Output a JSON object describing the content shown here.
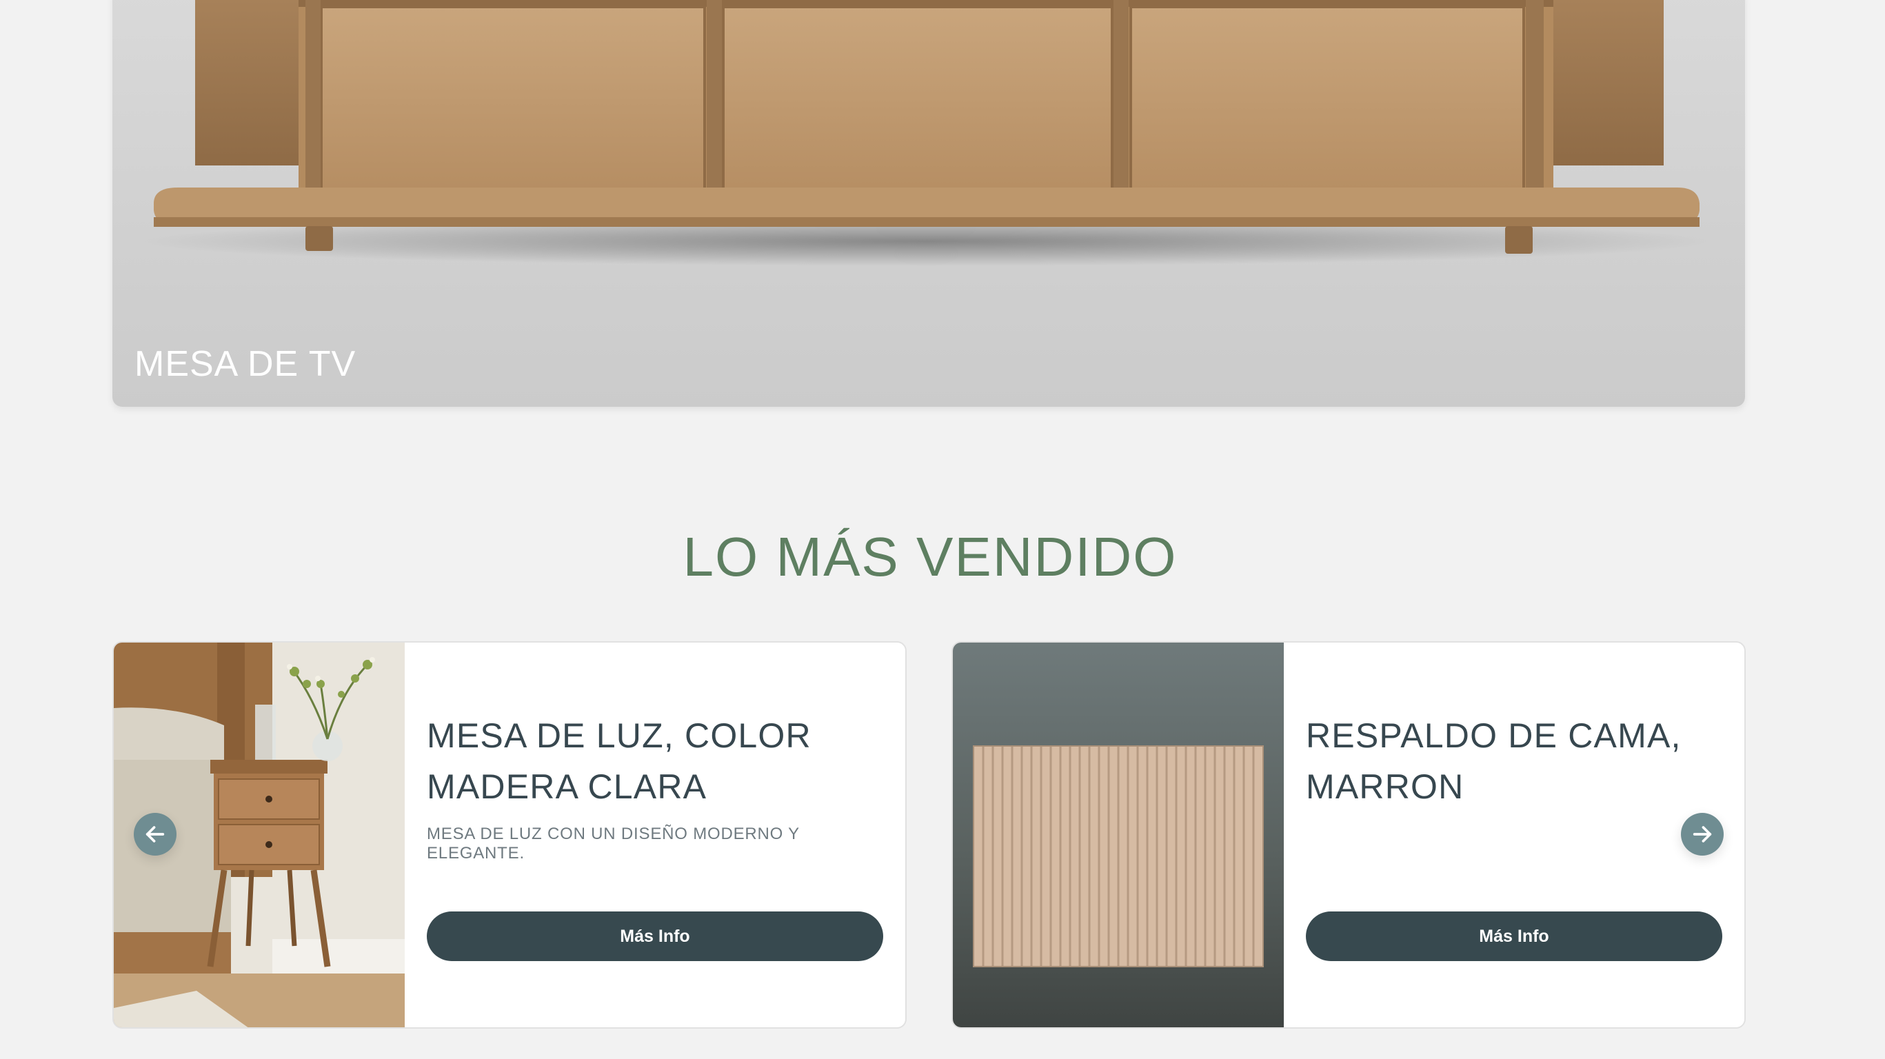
{
  "hero": {
    "title": "MESA DE TV"
  },
  "section": {
    "title": "LO MÁS VENDIDO"
  },
  "products": [
    {
      "title_line1": "MESA DE LUZ, COLOR",
      "title_line2": "MADERA CLARA",
      "description": "MESA DE LUZ CON UN DISEÑO MODERNO Y ELEGANTE.",
      "button_label": "Más Info"
    },
    {
      "title_line1": "RESPALDO DE CAMA,",
      "title_line2": "MARRON",
      "description": "",
      "button_label": "Más Info"
    }
  ],
  "carousel": {
    "prev_icon": "arrow-left-icon",
    "next_icon": "arrow-right-icon"
  },
  "colors": {
    "background": "#f2f2f2",
    "accent_green": "#5e7f61",
    "button": "#37494f",
    "arrow": "#6f8d92"
  }
}
